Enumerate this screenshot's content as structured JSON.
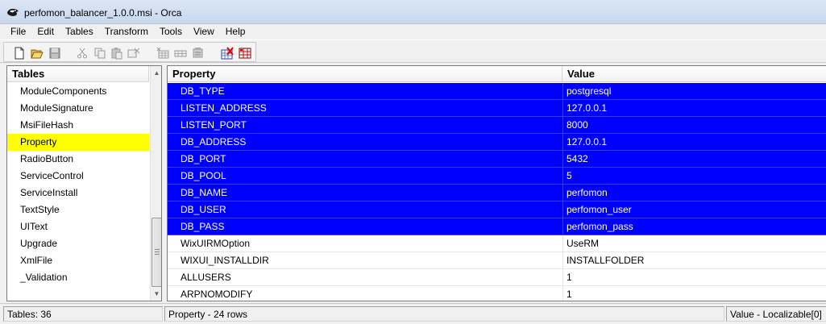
{
  "window": {
    "title": "perfomon_balancer_1.0.0.msi - Orca"
  },
  "menu": [
    "File",
    "Edit",
    "Tables",
    "Transform",
    "Tools",
    "View",
    "Help"
  ],
  "toolbar": {
    "buttons": [
      {
        "name": "new-icon"
      },
      {
        "name": "open-icon"
      },
      {
        "name": "save-icon"
      },
      {
        "name": "cut-icon"
      },
      {
        "name": "copy-icon"
      },
      {
        "name": "paste-icon"
      },
      {
        "name": "delete-icon"
      },
      {
        "name": "add-table-icon"
      },
      {
        "name": "add-row-icon"
      },
      {
        "name": "drop-row-icon"
      },
      {
        "name": "validate-icon"
      },
      {
        "name": "table-properties-icon"
      }
    ]
  },
  "tables_pane": {
    "header": "Tables",
    "items": [
      "ModuleComponents",
      "ModuleSignature",
      "MsiFileHash",
      "Property",
      "RadioButton",
      "ServiceControl",
      "ServiceInstall",
      "TextStyle",
      "UIText",
      "Upgrade",
      "XmlFile",
      "_Validation"
    ],
    "selected_index": 3,
    "selected_color": "#ffff00"
  },
  "grid": {
    "columns": [
      "Property",
      "Value"
    ],
    "rows": [
      {
        "property": "DB_TYPE",
        "value": "postgresql",
        "selected": true
      },
      {
        "property": "LISTEN_ADDRESS",
        "value": "127.0.0.1",
        "selected": true
      },
      {
        "property": "LISTEN_PORT",
        "value": "8000",
        "selected": true
      },
      {
        "property": "DB_ADDRESS",
        "value": "127.0.0.1",
        "selected": true
      },
      {
        "property": "DB_PORT",
        "value": "5432",
        "selected": true
      },
      {
        "property": "DB_POOL",
        "value": "5",
        "selected": true
      },
      {
        "property": "DB_NAME",
        "value": "perfomon",
        "selected": true
      },
      {
        "property": "DB_USER",
        "value": "perfomon_user",
        "selected": true
      },
      {
        "property": "DB_PASS",
        "value": "perfomon_pass",
        "selected": true
      },
      {
        "property": "WixUIRMOption",
        "value": "UseRM",
        "selected": false
      },
      {
        "property": "WIXUI_INSTALLDIR",
        "value": "INSTALLFOLDER",
        "selected": false
      },
      {
        "property": "ALLUSERS",
        "value": "1",
        "selected": false
      },
      {
        "property": "ARPNOMODIFY",
        "value": "1",
        "selected": false
      }
    ],
    "selection_color": "#0000ff"
  },
  "status": {
    "tables_count": "Tables: 36",
    "table_info": "Property - 24 rows",
    "column_info": "Value - Localizable[0]"
  }
}
